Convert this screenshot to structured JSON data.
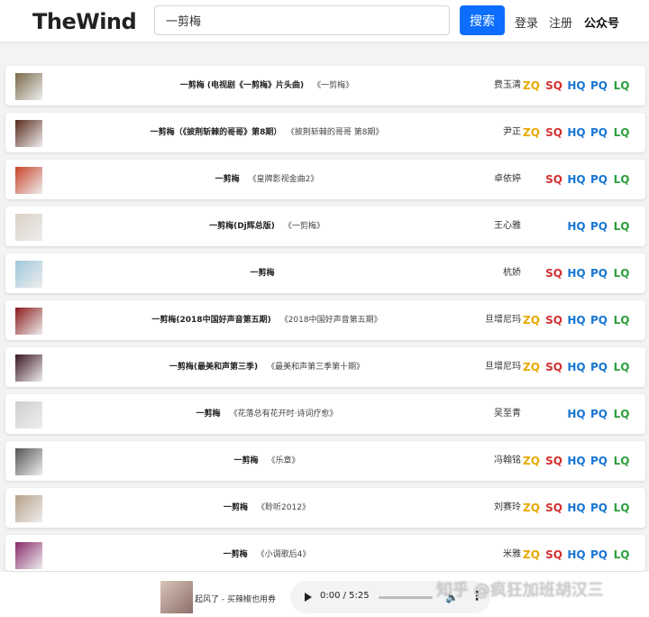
{
  "header": {
    "logo": "TheWind",
    "search_value": "一剪梅",
    "search_button": "搜索",
    "nav": {
      "login": "登录",
      "register": "注册",
      "wechat": "公众号"
    }
  },
  "colors": {
    "ZQ": "#e8a800",
    "SQ": "#d32f2f",
    "HQ": "#1976d2",
    "PQ": "#1976d2",
    "LQ": "#2e9e3e",
    "accent": "#0d6efd"
  },
  "songs": [
    {
      "name": "一剪梅 (电视剧《一剪梅》片头曲)",
      "album": "《一剪梅》",
      "artist": "费玉清",
      "qualities": [
        "ZQ",
        "SQ",
        "HQ",
        "PQ",
        "LQ"
      ],
      "cover": "#7b6a4a"
    },
    {
      "name": "一剪梅（《披荆斩棘的哥哥》第8期）",
      "album": "《披荆斩棘的哥哥 第8期》",
      "artist": "尹正",
      "qualities": [
        "ZQ",
        "SQ",
        "HQ",
        "PQ",
        "LQ"
      ],
      "cover": "#5a2a1e"
    },
    {
      "name": "一剪梅",
      "album": "《皇牌影视金曲2》",
      "artist": "卓依婷",
      "qualities": [
        "SQ",
        "HQ",
        "PQ",
        "LQ"
      ],
      "cover": "#c8432a"
    },
    {
      "name": "一剪梅(Dj辉总版)",
      "album": "《一剪梅》",
      "artist": "王心雅",
      "qualities": [
        "HQ",
        "PQ",
        "LQ"
      ],
      "cover": "#d9d0c4"
    },
    {
      "name": "一剪梅",
      "album": "",
      "artist": "杭娇",
      "qualities": [
        "SQ",
        "HQ",
        "PQ",
        "LQ"
      ],
      "cover": "#9ec7d9"
    },
    {
      "name": "一剪梅(2018中国好声音第五期)",
      "album": "《2018中国好声音第五期》",
      "artist": "旦增尼玛",
      "qualities": [
        "ZQ",
        "SQ",
        "HQ",
        "PQ",
        "LQ"
      ],
      "cover": "#8b1a1a"
    },
    {
      "name": "一剪梅(最美和声第三季)",
      "album": "《最美和声第三季第十期》",
      "artist": "旦增尼玛",
      "qualities": [
        "ZQ",
        "SQ",
        "HQ",
        "PQ",
        "LQ"
      ],
      "cover": "#3a1420"
    },
    {
      "name": "一剪梅",
      "album": "《花落总有花开时·诗词疗愈》",
      "artist": "吴至青",
      "qualities": [
        "HQ",
        "PQ",
        "LQ"
      ],
      "cover": "#cfcfcf"
    },
    {
      "name": "一剪梅",
      "album": "《乐章》",
      "artist": "冯翰铭",
      "qualities": [
        "ZQ",
        "SQ",
        "HQ",
        "PQ",
        "LQ"
      ],
      "cover": "#555555"
    },
    {
      "name": "一剪梅",
      "album": "《聆听2012》",
      "artist": "刘赛玲",
      "qualities": [
        "ZQ",
        "SQ",
        "HQ",
        "PQ",
        "LQ"
      ],
      "cover": "#b8a08a"
    },
    {
      "name": "一剪梅",
      "album": "《小调歌后4》",
      "artist": "米雅",
      "qualities": [
        "ZQ",
        "SQ",
        "HQ",
        "PQ",
        "LQ"
      ],
      "cover": "#8a2a6a"
    }
  ],
  "player": {
    "title": "起风了 - 买辣椒也用券",
    "time": "0:00 / 5:25",
    "progress": 0
  },
  "watermark": "知乎 @疯狂加班胡汉三"
}
